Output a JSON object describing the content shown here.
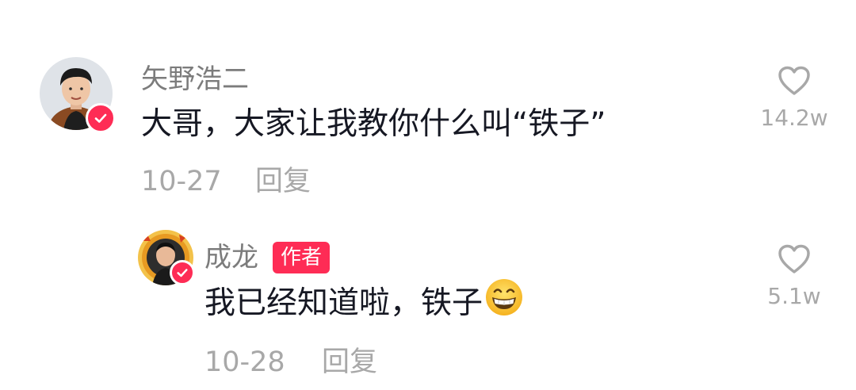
{
  "comments": [
    {
      "username": "矢野浩二",
      "text": "大哥，大家让我教你什么叫“铁子”",
      "date": "10-27",
      "reply_label": "回复",
      "like_count": "14.2w",
      "verified": true
    }
  ],
  "replies": [
    {
      "username": "成龙",
      "badge": "作者",
      "text": "我已经知道啦，铁子",
      "emoji": "grinning-face-icon",
      "date": "10-28",
      "reply_label": "回复",
      "like_count": "5.1w",
      "verified": true
    }
  ],
  "colors": {
    "accent": "#fe2c55",
    "username": "#7c7c7c",
    "text": "#161823",
    "meta": "#a8a8a8"
  }
}
